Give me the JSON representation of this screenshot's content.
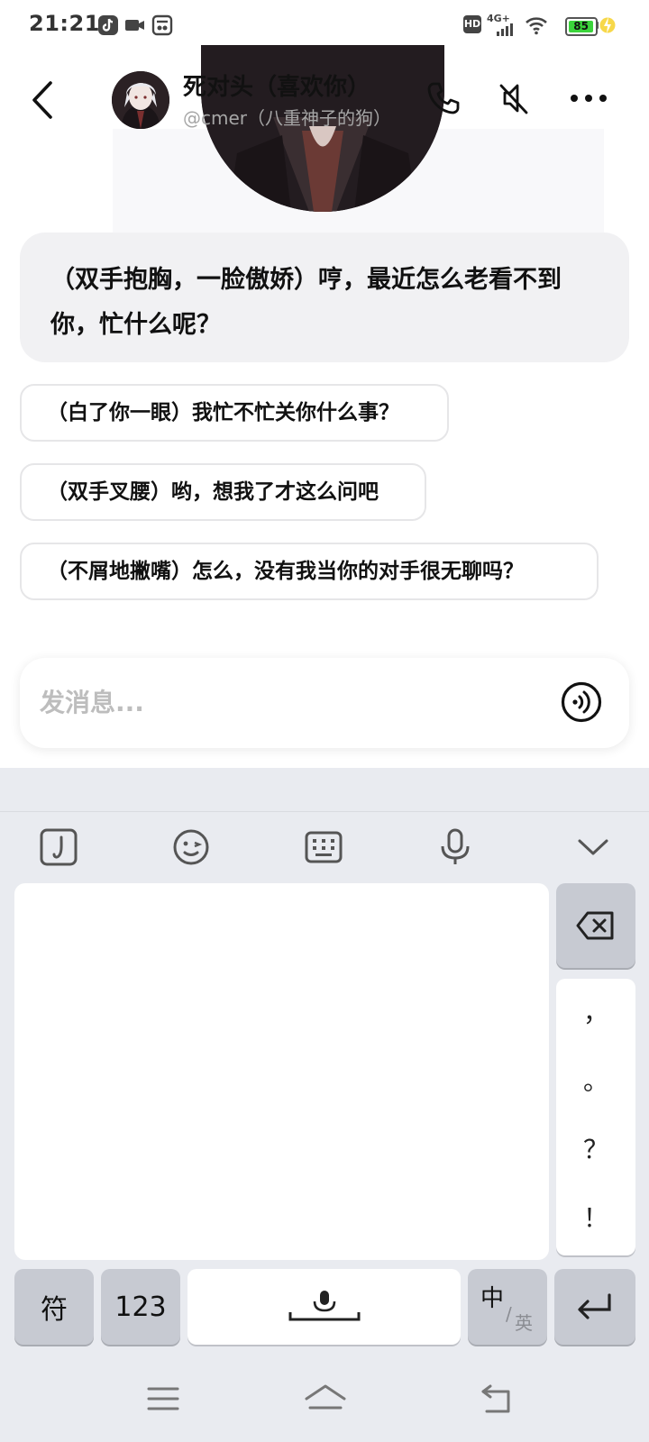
{
  "status_bar": {
    "time": "21:21",
    "network": "4G+",
    "hd_label": "HD",
    "battery_level": "85",
    "battery_fraction": 0.85,
    "battery_color": "#3bd43b"
  },
  "header": {
    "contact_name": "死对头（喜欢你）",
    "contact_handle": "@cmer（八重神子的狗）"
  },
  "messages": [
    {
      "role": "character",
      "text": "（双手抱胸，一脸傲娇）哼，最近怎么老看不到你，忙什么呢？"
    }
  ],
  "suggestions": [
    {
      "text": "（白了你一眼）我忙不忙关你什么事？"
    },
    {
      "text": "（双手叉腰）哟，想我了才这么问吧"
    },
    {
      "text": "（不屑地撇嘴）怎么，没有我当你的对手很无聊吗？"
    }
  ],
  "composer": {
    "placeholder": "发消息..."
  },
  "keyboard": {
    "toolbar_icons": [
      "handwriting-icon",
      "emoji-icon",
      "keyboard-icon",
      "microphone-icon",
      "collapse-keyboard-icon"
    ],
    "punctuation": [
      "，",
      "。",
      "？",
      "！"
    ],
    "keys": {
      "symbols": "符",
      "numbers": "123",
      "lang_main": "中",
      "lang_alt": "英"
    }
  },
  "colors": {
    "bubble_bg": "#f1f1f3",
    "keyboard_bg": "#e9ebf0",
    "function_key_bg": "#c7cad2"
  }
}
